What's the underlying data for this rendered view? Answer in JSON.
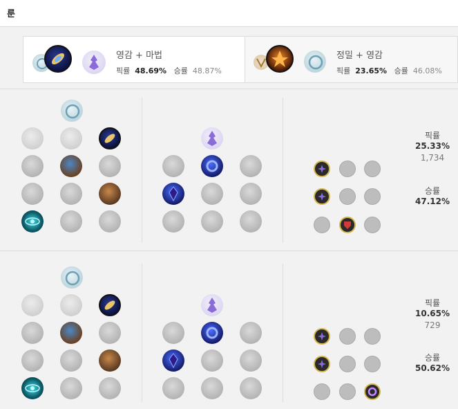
{
  "header": {
    "title": "룬"
  },
  "tabs": [
    {
      "label": "영감 + 마법",
      "pick_label": "픽률",
      "pick_value": "48.69%",
      "win_label": "승률",
      "win_value": "48.87%"
    },
    {
      "label": "정밀 + 영감",
      "pick_label": "픽률",
      "pick_value": "23.65%",
      "win_label": "승률",
      "win_value": "46.08%"
    }
  ],
  "builds": [
    {
      "pick_label": "픽률",
      "pick_value": "25.33%",
      "games": "1,734",
      "win_label": "승률",
      "win_value": "47.12%"
    },
    {
      "pick_label": "픽률",
      "pick_value": "10.65%",
      "games": "729",
      "win_label": "승률",
      "win_value": "50.62%"
    }
  ],
  "colors": {
    "shard_active_border": "#d3b54a",
    "shard_active_fill": "#2a2a2a",
    "inspiration": "#8a6bd8",
    "sorcery": "#5a86a3"
  }
}
